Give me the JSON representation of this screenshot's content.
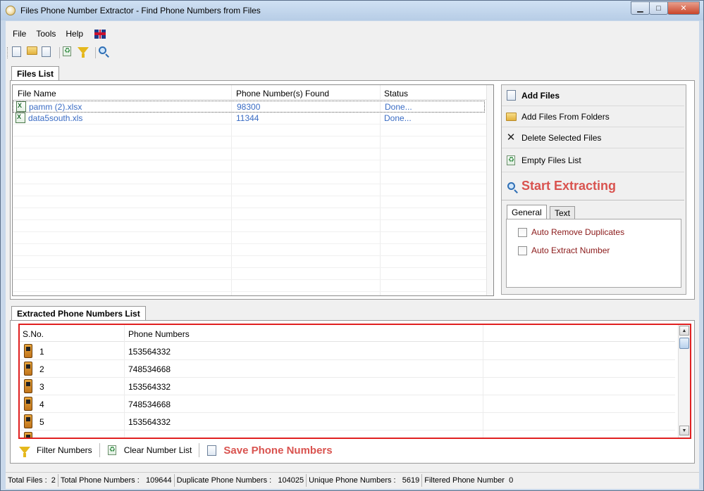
{
  "window": {
    "title": "Files Phone Number Extractor - Find Phone Numbers from Files",
    "minimize": "▁",
    "maximize": "□",
    "close": "✕"
  },
  "menu": {
    "file": "File",
    "tools": "Tools",
    "help": "Help"
  },
  "files_tab": {
    "label": "Files List"
  },
  "files_grid": {
    "columns": [
      "File Name",
      "Phone Number(s) Found",
      "Status"
    ],
    "rows": [
      {
        "name": "pamm (2).xlsx",
        "found": "98300",
        "status": "Done..."
      },
      {
        "name": "data5south.xls",
        "found": "11344",
        "status": "Done..."
      }
    ]
  },
  "actions": {
    "add_files": "Add Files",
    "add_folders": "Add Files From Folders",
    "delete_selected": "Delete Selected Files",
    "empty_list": "Empty Files List",
    "start": "Start Extracting"
  },
  "options": {
    "tabs": [
      "General",
      "Text"
    ],
    "auto_remove": "Auto Remove Duplicates",
    "auto_extract": "Auto Extract Number"
  },
  "extracted_tab": {
    "label": "Extracted Phone Numbers List"
  },
  "extracted_grid": {
    "columns": [
      "S.No.",
      "Phone Numbers"
    ],
    "rows": [
      {
        "sno": "1",
        "phone": "153564332"
      },
      {
        "sno": "2",
        "phone": "748534668"
      },
      {
        "sno": "3",
        "phone": "153564332"
      },
      {
        "sno": "4",
        "phone": "748534668"
      },
      {
        "sno": "5",
        "phone": "153564332"
      }
    ]
  },
  "extracted_toolbar": {
    "filter": "Filter Numbers",
    "clear": "Clear Number List",
    "save": "Save Phone Numbers"
  },
  "status": {
    "total_files_label": "Total Files :",
    "total_files": "2",
    "total_phone_label": "Total Phone Numbers :",
    "total_phone": "109644",
    "duplicate_label": "Duplicate Phone Numbers :",
    "duplicate": "104025",
    "unique_label": "Unique Phone Numbers :",
    "unique": "5619",
    "filtered_label": "Filtered Phone Number",
    "filtered": "0"
  }
}
